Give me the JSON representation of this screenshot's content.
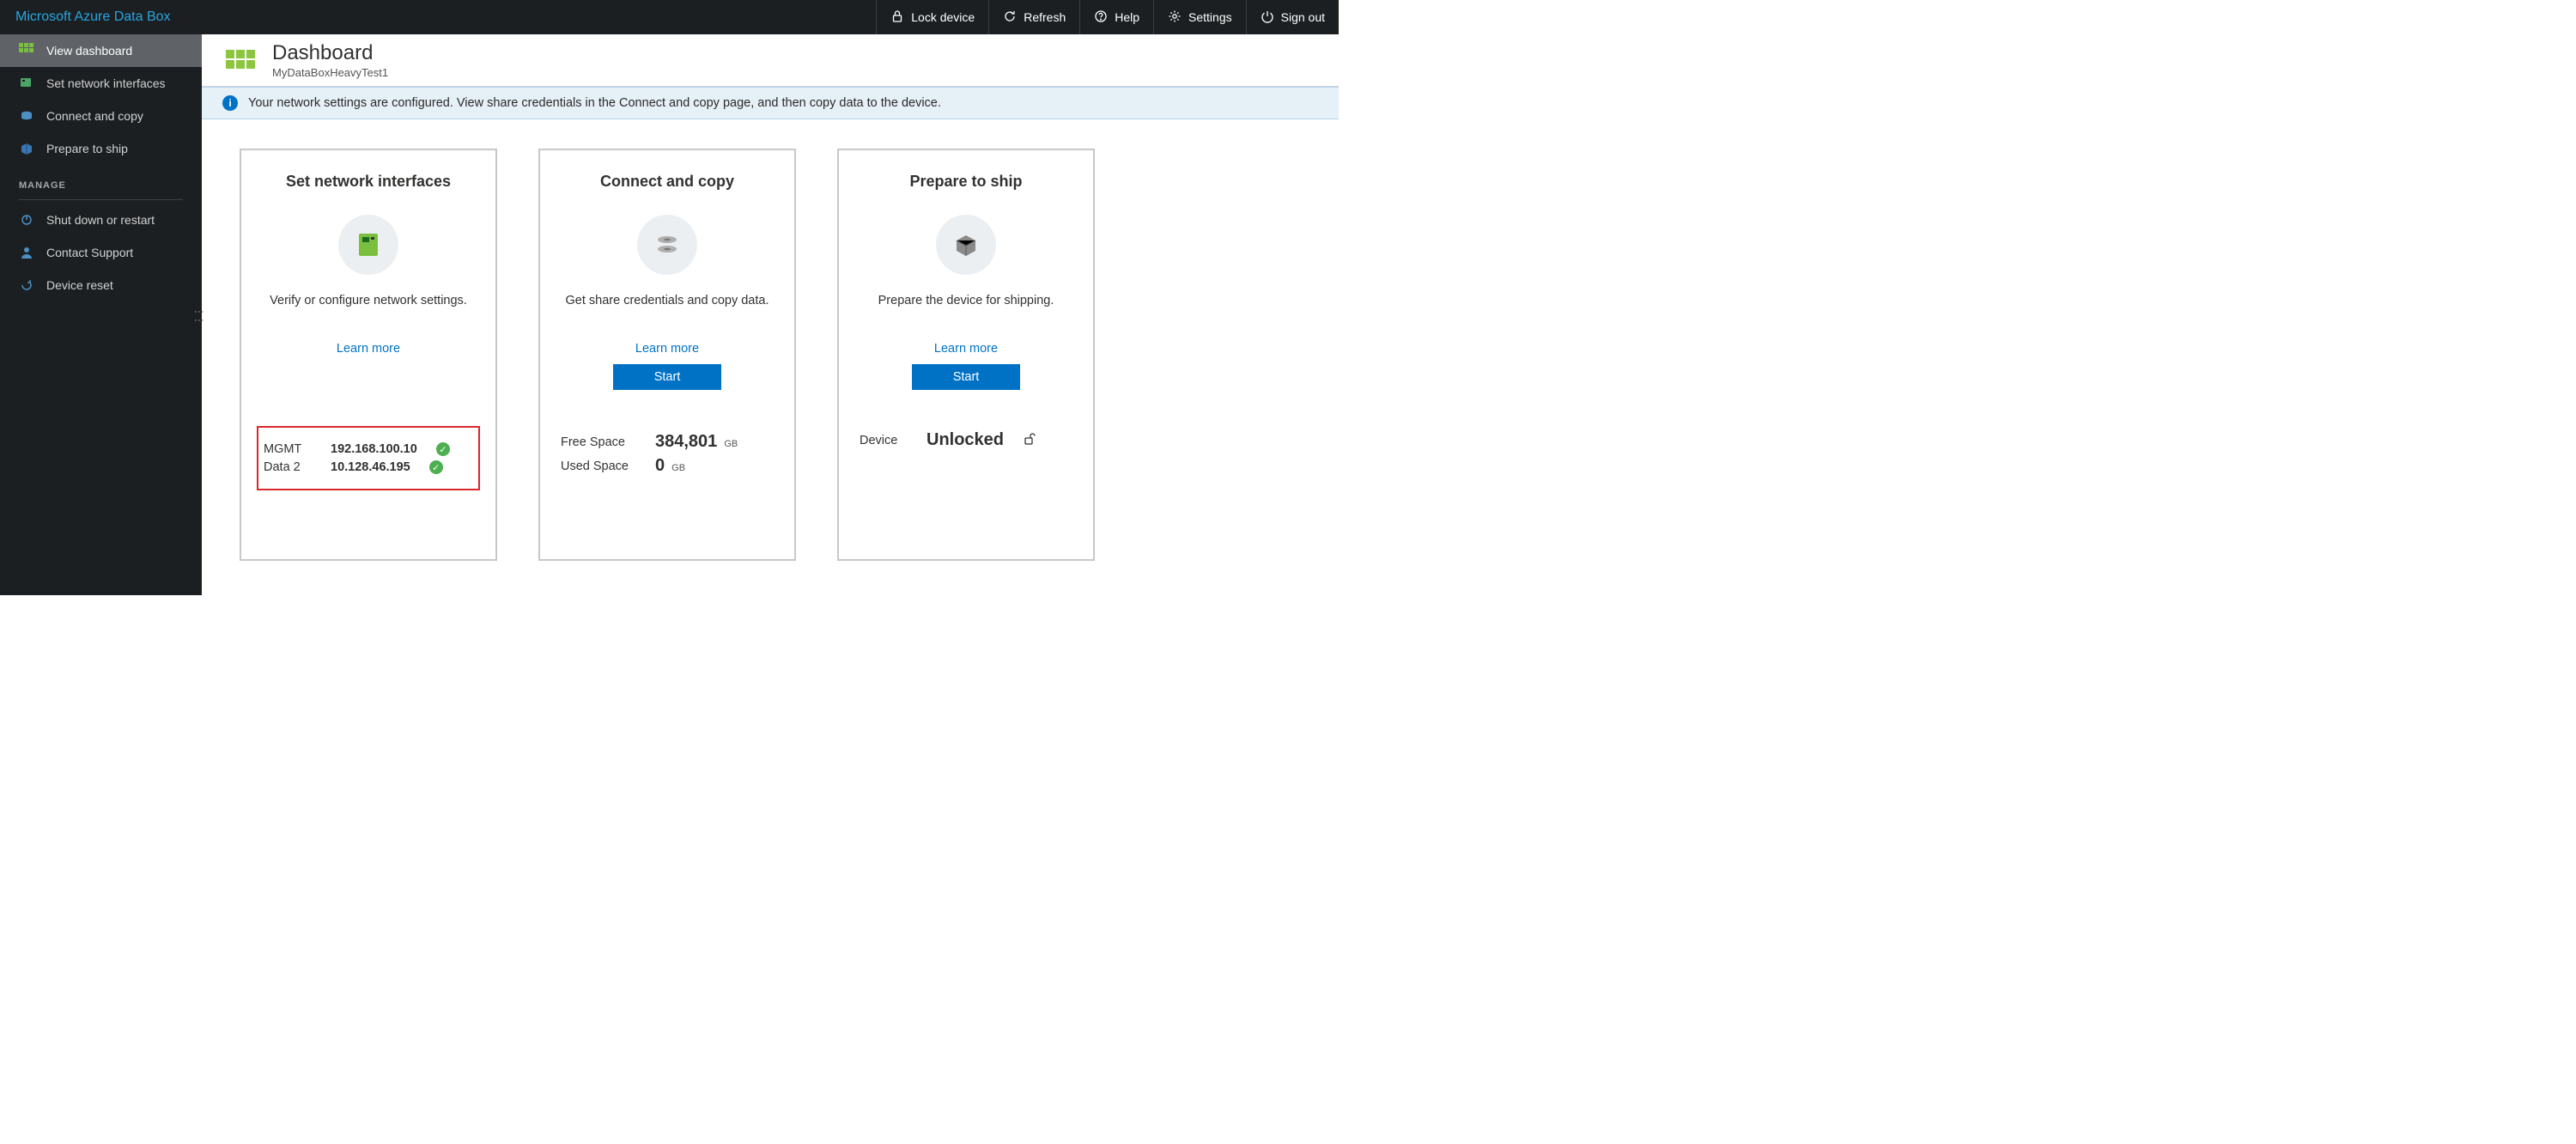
{
  "topbar": {
    "brand": "Microsoft Azure Data Box",
    "actions": {
      "lock": "Lock device",
      "refresh": "Refresh",
      "help": "Help",
      "settings": "Settings",
      "signout": "Sign out"
    }
  },
  "sidebar": {
    "items": [
      {
        "label": "View dashboard"
      },
      {
        "label": "Set network interfaces"
      },
      {
        "label": "Connect and copy"
      },
      {
        "label": "Prepare to ship"
      }
    ],
    "manage_heading": "MANAGE",
    "manage": [
      {
        "label": "Shut down or restart"
      },
      {
        "label": "Contact Support"
      },
      {
        "label": "Device reset"
      }
    ]
  },
  "header": {
    "title": "Dashboard",
    "subtitle": "MyDataBoxHeavyTest1"
  },
  "banner": {
    "text": "Your network settings are configured. View share credentials in the Connect and copy page, and then copy data to the device."
  },
  "cards": {
    "network": {
      "title": "Set network interfaces",
      "desc": "Verify or configure network settings.",
      "learn": "Learn more",
      "rows": [
        {
          "k": "MGMT",
          "v": "192.168.100.10"
        },
        {
          "k": "Data 2",
          "v": "10.128.46.195"
        }
      ]
    },
    "connect": {
      "title": "Connect and copy",
      "desc": "Get share credentials and copy data.",
      "learn": "Learn more",
      "start": "Start",
      "rows": [
        {
          "k": "Free Space",
          "v": "384,801",
          "unit": "GB"
        },
        {
          "k": "Used Space",
          "v": "0",
          "unit": "GB"
        }
      ]
    },
    "ship": {
      "title": "Prepare to ship",
      "desc": "Prepare the device for shipping.",
      "learn": "Learn more",
      "start": "Start",
      "rows": [
        {
          "k": "Device",
          "v": "Unlocked"
        }
      ]
    }
  }
}
